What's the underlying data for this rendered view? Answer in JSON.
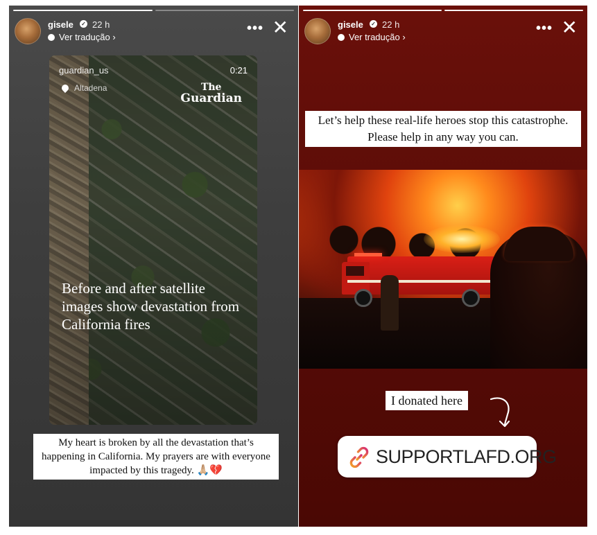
{
  "stories": [
    {
      "username": "gisele",
      "time": "22 h",
      "translate": "Ver tradução",
      "more_glyph": "•••",
      "close_glyph": "✕",
      "media": {
        "source": "guardian_us",
        "duration": "0:21",
        "location": "Altadena",
        "logo_line1": "The",
        "logo_line2": "Guardian",
        "headline": "Before and after satellite images show devastation from California fires"
      },
      "caption": "My heart is broken by all the devastation that’s happening in California. My prayers are with everyone impacted by this tragedy. 🙏🏼💔"
    },
    {
      "username": "gisele",
      "time": "22 h",
      "translate": "Ver tradução",
      "more_glyph": "•••",
      "close_glyph": "✕",
      "caption": "Let’s help these real-life heroes stop this catastrophe. Please help in any way you can.",
      "donated_text": "I donated here",
      "link_label": "SUPPORTLAFD.ORG"
    }
  ],
  "icons": [
    "verified-badge-icon",
    "translate-bubble-icon",
    "location-pin-icon",
    "curved-arrow-icon",
    "link-icon"
  ],
  "colors": {
    "left_bg": "#3e3e3e",
    "right_bg": "#5a0c07",
    "link_gradient_start": "#f5a623",
    "link_gradient_end": "#d62976"
  }
}
